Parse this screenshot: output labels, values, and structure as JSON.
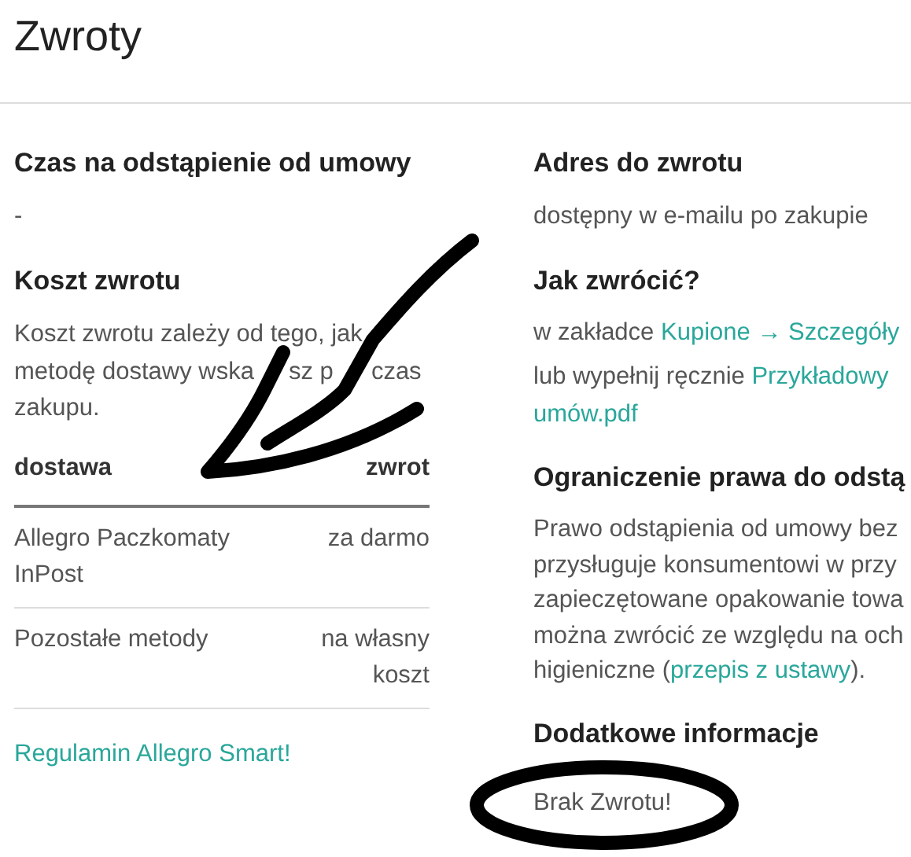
{
  "title": "Zwroty",
  "left": {
    "withdrawal": {
      "heading": "Czas na odstąpienie od umowy",
      "value": "-"
    },
    "cost": {
      "heading": "Koszt zwrotu",
      "lines": [
        [
          "Koszt zwrotu zależy od tego, jak"
        ],
        [
          "metodę dostawy wska",
          "sz p",
          "czas"
        ],
        [
          "zakupu."
        ]
      ],
      "table": {
        "columns": [
          "dostawa",
          "zwrot"
        ],
        "rows": [
          {
            "delivery": [
              "Allegro Paczkomaty",
              "InPost"
            ],
            "cost": [
              "za darmo"
            ]
          },
          {
            "delivery": [
              "Pozostałe metody"
            ],
            "cost": [
              "na własny",
              "koszt"
            ]
          }
        ]
      }
    },
    "link": "Regulamin Allegro Smart!"
  },
  "right": {
    "address": {
      "heading": "Adres do zwrotu",
      "value": "dostępny w e-mailu po zakupie"
    },
    "how": {
      "heading": "Jak zwrócić?",
      "line1_text": "w zakładce",
      "line1_link": "Kupione → Szczegóły",
      "line2_text": "lub wypełnij ręcznie",
      "line2_link": "Przykładowy",
      "line3_link": "umów.pdf"
    },
    "limit": {
      "heading": "Ograniczenie prawa do odstą",
      "lines": [
        "Prawo odstąpienia od umowy bez",
        "przysługuje konsumentowi w przy",
        "zapieczętowane opakowanie towa",
        "można zwrócić ze względu na och"
      ],
      "last_text": "higieniczne (",
      "last_link": "przepis z ustawy",
      "last_end": ")."
    },
    "extra": {
      "heading": "Dodatkowe informacje",
      "value": "Brak Zwrotu!"
    }
  }
}
